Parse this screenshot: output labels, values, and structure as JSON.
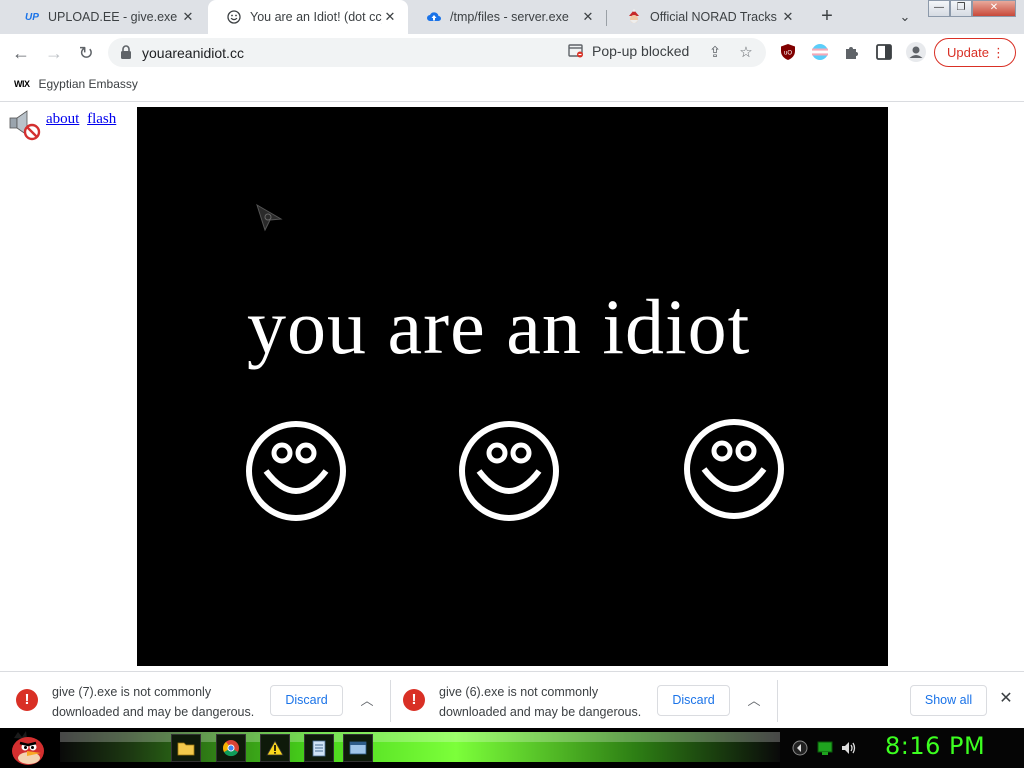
{
  "window": {
    "minimize_label": "—",
    "restore_label": "❐",
    "close_label": "✕"
  },
  "tabs": [
    {
      "title": "UPLOAD.EE - give.exe - D",
      "favicon": "UP",
      "active": false
    },
    {
      "title": "You are an Idiot! (dot cc)",
      "favicon": "smiley-icon",
      "active": true
    },
    {
      "title": "/tmp/files - server.exe",
      "favicon": "cloud-upload-icon",
      "active": false
    },
    {
      "title": "Official NORAD Tracks Sa",
      "favicon": "santa-icon",
      "active": false
    }
  ],
  "tabstrip": {
    "new_tab": "+",
    "tab_search": "⌄"
  },
  "toolbar": {
    "back": "←",
    "forward": "→",
    "reload": "↻",
    "url": "youareanidiot.cc",
    "popup_blocked": "Pop-up blocked",
    "update_label": "Update",
    "menu": "⋮"
  },
  "bookmarks": [
    {
      "label": "Egyptian Embassy",
      "icon": "WIX"
    }
  ],
  "page": {
    "links": [
      "about",
      "flash"
    ],
    "headline": "you are an idiot",
    "smiley_count": 3,
    "colors": {
      "stage": "#000000",
      "text": "#ffffff",
      "link": "#0000ee"
    }
  },
  "downloads": [
    {
      "message": "give (7).exe is not commonly downloaded and may be dangerous.",
      "action": "Discard"
    },
    {
      "message": "give (6).exe is not commonly downloaded and may be dangerous.",
      "action": "Discard"
    }
  ],
  "download_bar": {
    "show_all": "Show all",
    "close": "✕"
  },
  "taskbar": {
    "clock": "8:16 PM",
    "accent": "#3cff20"
  }
}
